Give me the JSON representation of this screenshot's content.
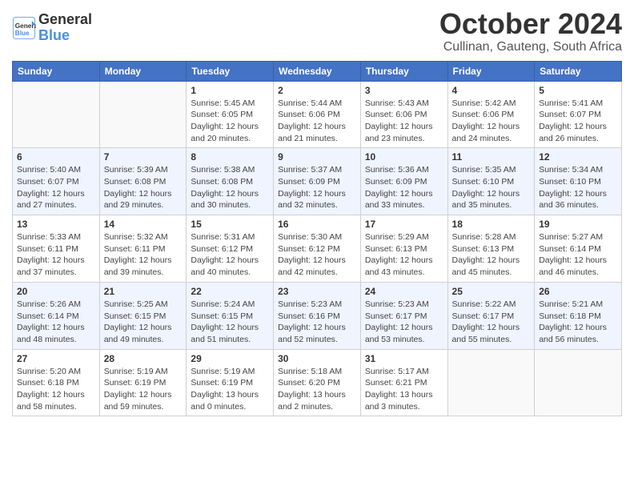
{
  "header": {
    "logo_line1": "General",
    "logo_line2": "Blue",
    "month": "October 2024",
    "location": "Cullinan, Gauteng, South Africa"
  },
  "columns": [
    "Sunday",
    "Monday",
    "Tuesday",
    "Wednesday",
    "Thursday",
    "Friday",
    "Saturday"
  ],
  "weeks": [
    [
      {
        "day": "",
        "info": ""
      },
      {
        "day": "",
        "info": ""
      },
      {
        "day": "1",
        "info": "Sunrise: 5:45 AM\nSunset: 6:05 PM\nDaylight: 12 hours and 20 minutes."
      },
      {
        "day": "2",
        "info": "Sunrise: 5:44 AM\nSunset: 6:06 PM\nDaylight: 12 hours and 21 minutes."
      },
      {
        "day": "3",
        "info": "Sunrise: 5:43 AM\nSunset: 6:06 PM\nDaylight: 12 hours and 23 minutes."
      },
      {
        "day": "4",
        "info": "Sunrise: 5:42 AM\nSunset: 6:06 PM\nDaylight: 12 hours and 24 minutes."
      },
      {
        "day": "5",
        "info": "Sunrise: 5:41 AM\nSunset: 6:07 PM\nDaylight: 12 hours and 26 minutes."
      }
    ],
    [
      {
        "day": "6",
        "info": "Sunrise: 5:40 AM\nSunset: 6:07 PM\nDaylight: 12 hours and 27 minutes."
      },
      {
        "day": "7",
        "info": "Sunrise: 5:39 AM\nSunset: 6:08 PM\nDaylight: 12 hours and 29 minutes."
      },
      {
        "day": "8",
        "info": "Sunrise: 5:38 AM\nSunset: 6:08 PM\nDaylight: 12 hours and 30 minutes."
      },
      {
        "day": "9",
        "info": "Sunrise: 5:37 AM\nSunset: 6:09 PM\nDaylight: 12 hours and 32 minutes."
      },
      {
        "day": "10",
        "info": "Sunrise: 5:36 AM\nSunset: 6:09 PM\nDaylight: 12 hours and 33 minutes."
      },
      {
        "day": "11",
        "info": "Sunrise: 5:35 AM\nSunset: 6:10 PM\nDaylight: 12 hours and 35 minutes."
      },
      {
        "day": "12",
        "info": "Sunrise: 5:34 AM\nSunset: 6:10 PM\nDaylight: 12 hours and 36 minutes."
      }
    ],
    [
      {
        "day": "13",
        "info": "Sunrise: 5:33 AM\nSunset: 6:11 PM\nDaylight: 12 hours and 37 minutes."
      },
      {
        "day": "14",
        "info": "Sunrise: 5:32 AM\nSunset: 6:11 PM\nDaylight: 12 hours and 39 minutes."
      },
      {
        "day": "15",
        "info": "Sunrise: 5:31 AM\nSunset: 6:12 PM\nDaylight: 12 hours and 40 minutes."
      },
      {
        "day": "16",
        "info": "Sunrise: 5:30 AM\nSunset: 6:12 PM\nDaylight: 12 hours and 42 minutes."
      },
      {
        "day": "17",
        "info": "Sunrise: 5:29 AM\nSunset: 6:13 PM\nDaylight: 12 hours and 43 minutes."
      },
      {
        "day": "18",
        "info": "Sunrise: 5:28 AM\nSunset: 6:13 PM\nDaylight: 12 hours and 45 minutes."
      },
      {
        "day": "19",
        "info": "Sunrise: 5:27 AM\nSunset: 6:14 PM\nDaylight: 12 hours and 46 minutes."
      }
    ],
    [
      {
        "day": "20",
        "info": "Sunrise: 5:26 AM\nSunset: 6:14 PM\nDaylight: 12 hours and 48 minutes."
      },
      {
        "day": "21",
        "info": "Sunrise: 5:25 AM\nSunset: 6:15 PM\nDaylight: 12 hours and 49 minutes."
      },
      {
        "day": "22",
        "info": "Sunrise: 5:24 AM\nSunset: 6:15 PM\nDaylight: 12 hours and 51 minutes."
      },
      {
        "day": "23",
        "info": "Sunrise: 5:23 AM\nSunset: 6:16 PM\nDaylight: 12 hours and 52 minutes."
      },
      {
        "day": "24",
        "info": "Sunrise: 5:23 AM\nSunset: 6:17 PM\nDaylight: 12 hours and 53 minutes."
      },
      {
        "day": "25",
        "info": "Sunrise: 5:22 AM\nSunset: 6:17 PM\nDaylight: 12 hours and 55 minutes."
      },
      {
        "day": "26",
        "info": "Sunrise: 5:21 AM\nSunset: 6:18 PM\nDaylight: 12 hours and 56 minutes."
      }
    ],
    [
      {
        "day": "27",
        "info": "Sunrise: 5:20 AM\nSunset: 6:18 PM\nDaylight: 12 hours and 58 minutes."
      },
      {
        "day": "28",
        "info": "Sunrise: 5:19 AM\nSunset: 6:19 PM\nDaylight: 12 hours and 59 minutes."
      },
      {
        "day": "29",
        "info": "Sunrise: 5:19 AM\nSunset: 6:19 PM\nDaylight: 13 hours and 0 minutes."
      },
      {
        "day": "30",
        "info": "Sunrise: 5:18 AM\nSunset: 6:20 PM\nDaylight: 13 hours and 2 minutes."
      },
      {
        "day": "31",
        "info": "Sunrise: 5:17 AM\nSunset: 6:21 PM\nDaylight: 13 hours and 3 minutes."
      },
      {
        "day": "",
        "info": ""
      },
      {
        "day": "",
        "info": ""
      }
    ]
  ]
}
